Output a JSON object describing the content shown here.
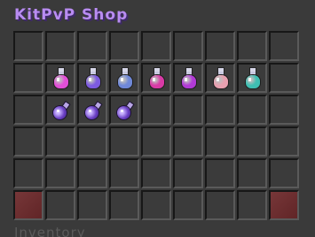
{
  "window": {
    "title": "KitPvP Shop",
    "inventory_label": "Inventory"
  },
  "grid": {
    "rows": 6,
    "columns": 9
  },
  "items": [
    {
      "row": 1,
      "col": 1,
      "type": "splash-potion",
      "color": "#e24fd7"
    },
    {
      "row": 1,
      "col": 2,
      "type": "splash-potion",
      "color": "#7d5be0"
    },
    {
      "row": 1,
      "col": 3,
      "type": "splash-potion",
      "color": "#6f88d8"
    },
    {
      "row": 1,
      "col": 4,
      "type": "splash-potion",
      "color": "#d93aa6"
    },
    {
      "row": 1,
      "col": 5,
      "type": "splash-potion",
      "color": "#b13ad6"
    },
    {
      "row": 1,
      "col": 6,
      "type": "splash-potion",
      "color": "#e8a0b0"
    },
    {
      "row": 1,
      "col": 7,
      "type": "splash-potion",
      "color": "#3fbfb3"
    },
    {
      "row": 2,
      "col": 1,
      "type": "lingering-potion",
      "color": "#6a3fc4"
    },
    {
      "row": 2,
      "col": 2,
      "type": "lingering-potion",
      "color": "#6a3fc4"
    },
    {
      "row": 2,
      "col": 3,
      "type": "lingering-potion",
      "color": "#6a3fc4"
    }
  ],
  "special_slots": [
    {
      "row": 5,
      "col": 0,
      "type": "close",
      "color": "#6e2a2c"
    },
    {
      "row": 5,
      "col": 8,
      "type": "close",
      "color": "#6e2a2c"
    }
  ]
}
